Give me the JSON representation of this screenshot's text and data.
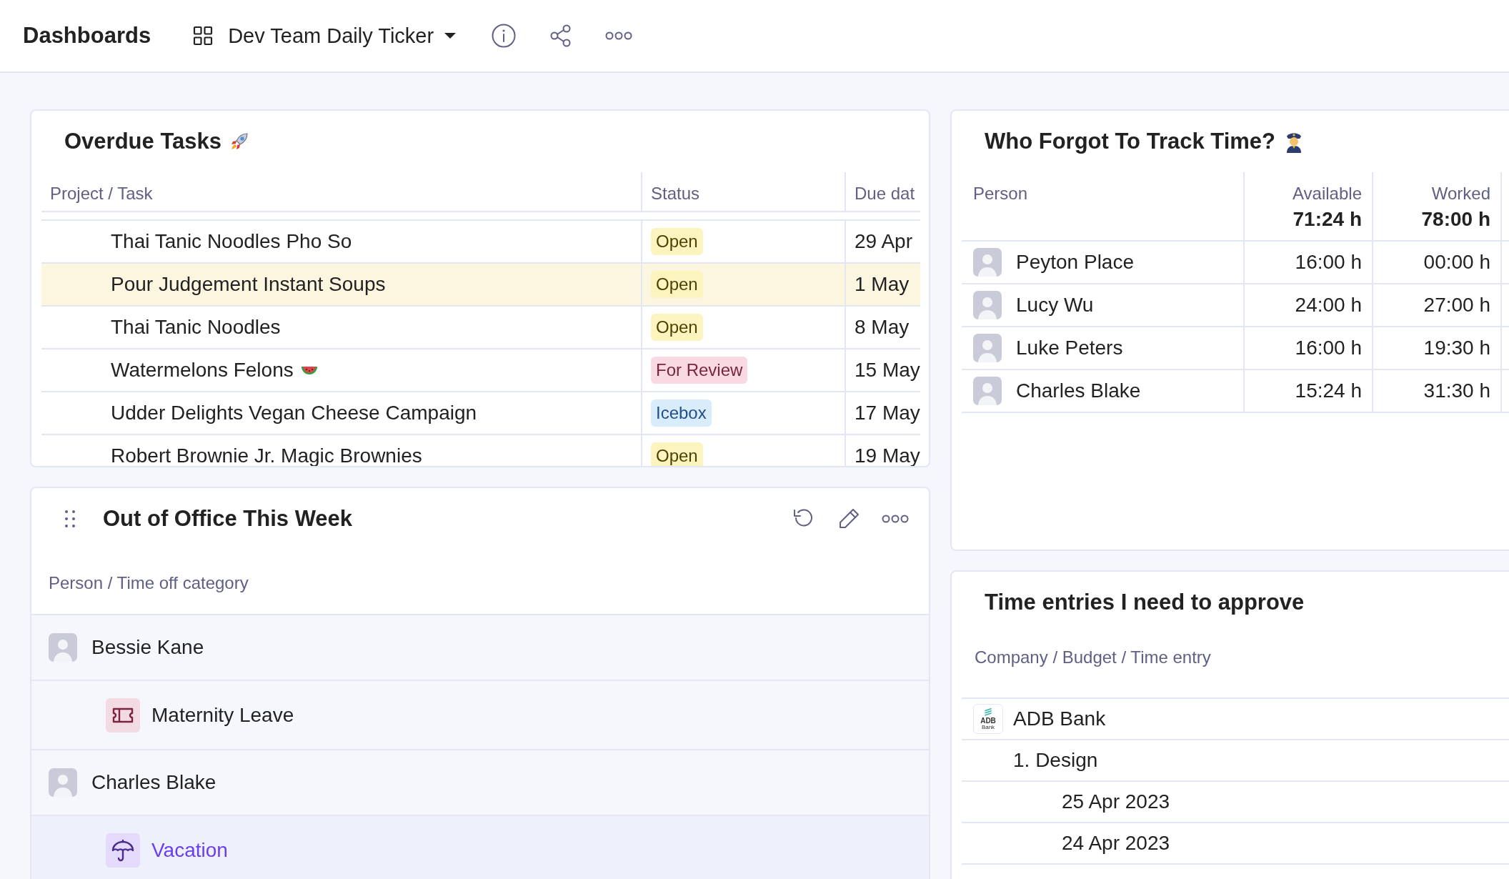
{
  "header": {
    "title": "Dashboards",
    "dashboard_name": "Dev Team Daily Ticker"
  },
  "overdue_tasks": {
    "title": "Overdue Tasks",
    "columns": [
      "Project / Task",
      "Status",
      "Due dat"
    ],
    "rows": [
      {
        "task": "Thai Tanic Noodles Pho So",
        "emoji": false,
        "status": "Open",
        "kind": "open",
        "due": "29 Apr",
        "highlighted": false
      },
      {
        "task": "Pour Judgement Instant Soups",
        "emoji": false,
        "status": "Open",
        "kind": "open",
        "due": "1 May",
        "highlighted": true
      },
      {
        "task": "Thai Tanic Noodles",
        "emoji": false,
        "status": "Open",
        "kind": "open",
        "due": "8 May",
        "highlighted": false
      },
      {
        "task": "Watermelons Felons",
        "emoji": true,
        "status": "For Review",
        "kind": "review",
        "due": "15 May",
        "highlighted": false
      },
      {
        "task": "Udder Delights Vegan Cheese Campaign",
        "emoji": false,
        "status": "Icebox",
        "kind": "icebox",
        "due": "17 May",
        "highlighted": false
      },
      {
        "task": "Robert Brownie Jr. Magic Brownies",
        "emoji": false,
        "status": "Open",
        "kind": "open",
        "due": "19 May",
        "highlighted": false
      }
    ]
  },
  "out_of_office": {
    "title": "Out of Office This Week",
    "column": "Person / Time off category",
    "people": [
      {
        "name": "Bessie Kane",
        "highlighted": false,
        "children": [
          {
            "name": "Maternity Leave",
            "kind": "leave",
            "highlighted": false
          }
        ]
      },
      {
        "name": "Charles Blake",
        "highlighted": false,
        "children": [
          {
            "name": "Vacation",
            "kind": "vacation",
            "highlighted": true
          }
        ]
      }
    ]
  },
  "time_tracking": {
    "title": "Who Forgot To Track Time?",
    "columns": [
      {
        "label": "Person"
      },
      {
        "label": "Available",
        "total": "71:24 h"
      },
      {
        "label": "Worked",
        "total": "78:00 h"
      }
    ],
    "rows": [
      {
        "name": "Peyton Place",
        "available": "16:00 h",
        "worked": "00:00 h"
      },
      {
        "name": "Lucy Wu",
        "available": "24:00 h",
        "worked": "27:00 h"
      },
      {
        "name": "Luke Peters",
        "available": "16:00 h",
        "worked": "19:30 h"
      },
      {
        "name": "Charles Blake",
        "available": "15:24 h",
        "worked": "31:30 h"
      }
    ]
  },
  "approvals": {
    "title": "Time entries I need to approve",
    "column": "Company / Budget / Time entry",
    "rows": [
      {
        "name": "ADB Bank",
        "logo_text": "ADB",
        "logo_subtext": "Bank",
        "children": [
          {
            "name": "1. Design",
            "children": [
              {
                "name": "25 Apr 2023"
              },
              {
                "name": "24 Apr 2023"
              }
            ]
          }
        ]
      }
    ]
  }
}
